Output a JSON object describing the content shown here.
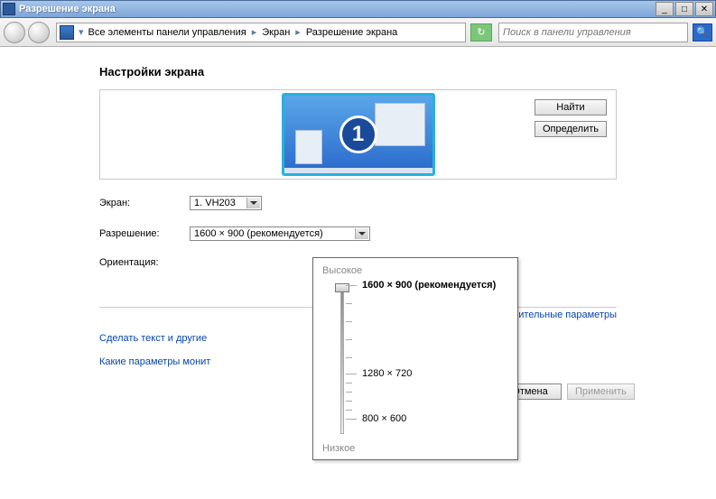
{
  "window": {
    "title": "Разрешение экрана"
  },
  "breadcrumb": {
    "seg1": "Все элементы панели управления",
    "seg2": "Экран",
    "seg3": "Разрешение экрана"
  },
  "search": {
    "placeholder": "Поиск в панели управления"
  },
  "heading": "Настройки экрана",
  "monitor_number": "1",
  "buttons": {
    "find": "Найти",
    "detect": "Определить",
    "cancel": "Отмена",
    "apply": "Применить"
  },
  "labels": {
    "screen": "Экран:",
    "resolution": "Разрешение:",
    "orientation": "Ориентация:"
  },
  "screen_value": "1. VH203",
  "resolution_value": "1600 × 900 (рекомендуется)",
  "links": {
    "advanced": "Дополнительные параметры",
    "text_size": "Сделать текст и другие",
    "monitor_params": "Какие параметры монит"
  },
  "slider": {
    "top": "Высокое",
    "bottom": "Низкое",
    "ticks": [
      {
        "pos": 0,
        "label": "1600 × 900 (рекомендуется)",
        "bold": true
      },
      {
        "pos": 98,
        "label": "1280 × 720",
        "bold": false
      },
      {
        "pos": 148,
        "label": "800 × 600",
        "bold": false
      }
    ]
  }
}
